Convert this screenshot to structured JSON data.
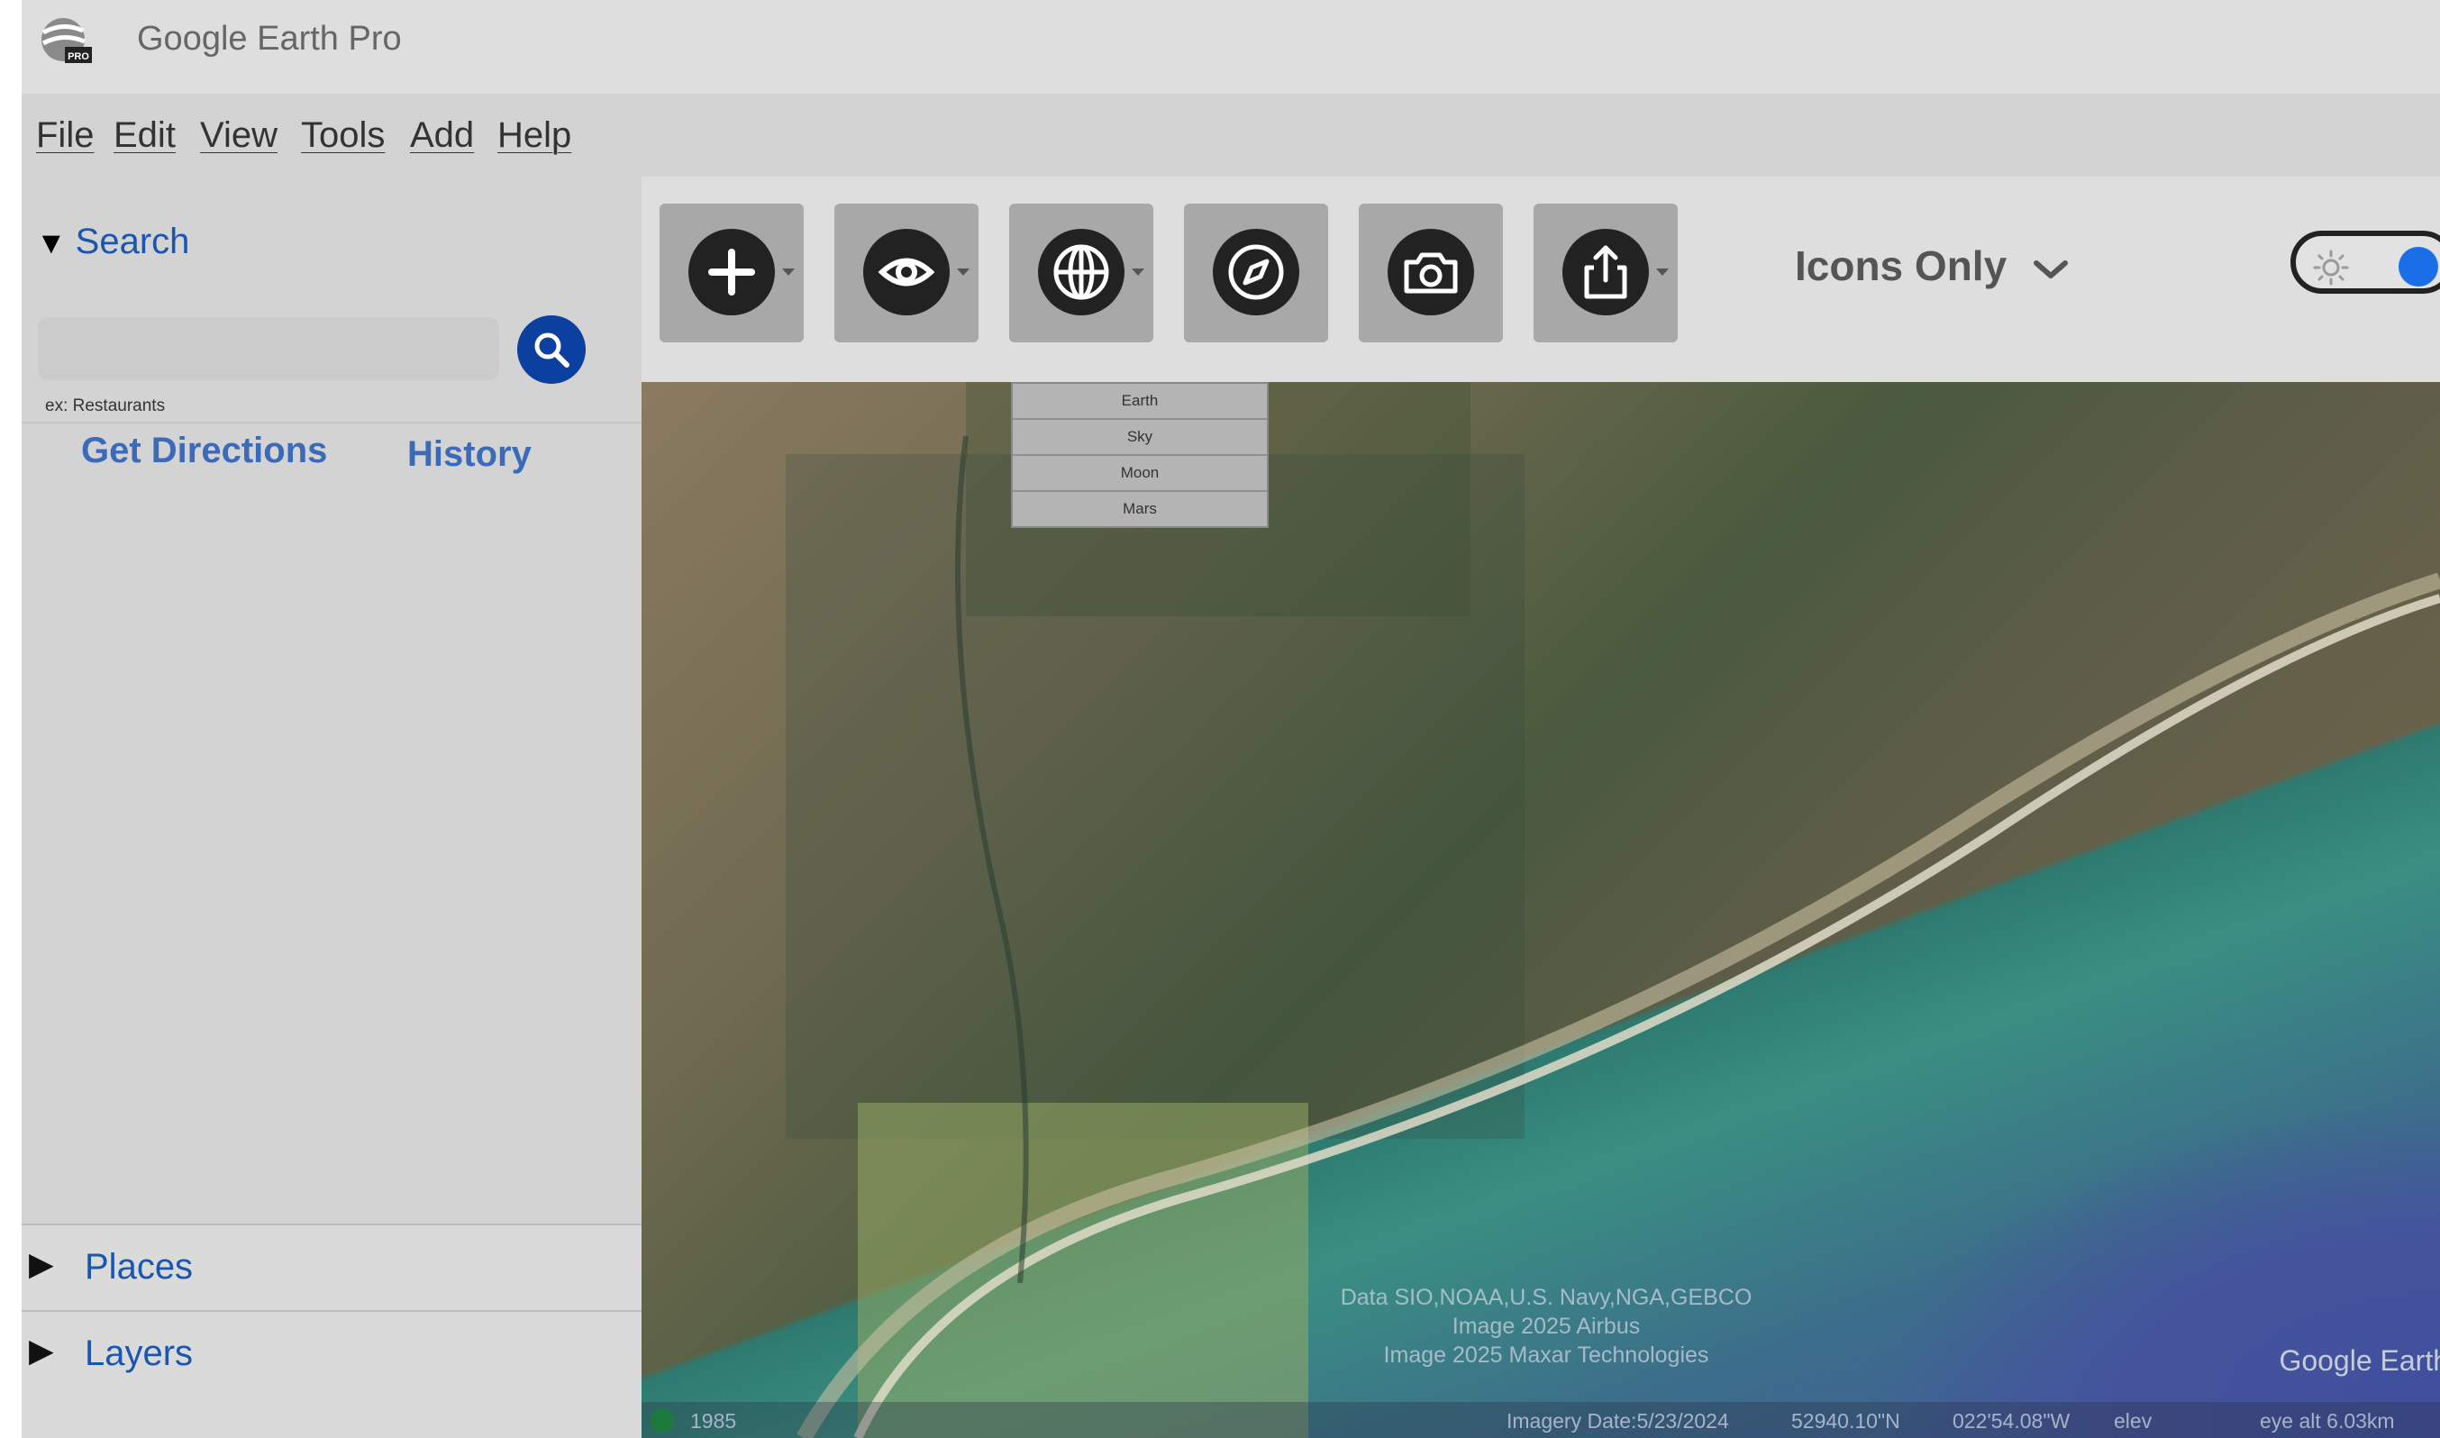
{
  "app": {
    "title": "Google Earth Pro",
    "logo": "google-earth-pro-logo"
  },
  "menu": [
    {
      "label": "File"
    },
    {
      "label": "Edit"
    },
    {
      "label": "View"
    },
    {
      "label": "Tools"
    },
    {
      "label": "Add"
    },
    {
      "label": "Help"
    }
  ],
  "sidebar": {
    "search_header": "Search",
    "search": {
      "value": "",
      "placeholder": ""
    },
    "search_hint": "ex: Restaurants",
    "get_directions": "Get Directions",
    "history": "History",
    "places": "Places",
    "layers": "Layers"
  },
  "toolbar": {
    "buttons": [
      {
        "icon": "add-icon"
      },
      {
        "icon": "eye-icon"
      },
      {
        "icon": "globe-icon"
      },
      {
        "icon": "compass-icon"
      },
      {
        "icon": "camera-icon"
      },
      {
        "icon": "share-icon"
      }
    ],
    "view_mode": "Icons Only",
    "theme_toggle": {
      "state": "on",
      "icon": "sun-icon",
      "accent": "#1a6ee8"
    }
  },
  "planet_menu": [
    "Earth",
    "Sky",
    "Moon",
    "Mars"
  ],
  "map": {
    "credits": [
      "Data SIO,NOAA,U.S. Navy,NGA,GEBCO",
      "Image  2025 Airbus",
      "Image 2025 Maxar Technologies"
    ],
    "watermark": "Google Earth",
    "timeline_year": "1985",
    "imagery_date": "Imagery Date:5/23/2024",
    "latitude": "52940.10\"N",
    "longitude": "022'54.08\"W",
    "elev": "elev",
    "eye_alt": "eye alt  6.03km"
  },
  "colors": {
    "link": "#1a56b0",
    "search_button": "#0b3fa0",
    "toggle_accent": "#1a6ee8"
  }
}
